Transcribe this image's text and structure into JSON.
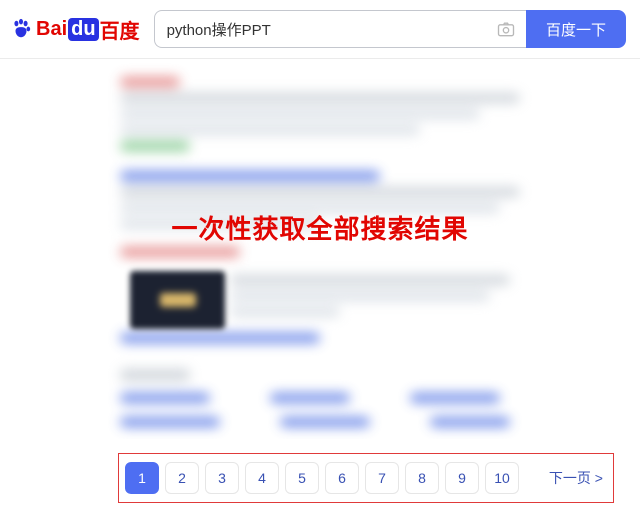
{
  "logo": {
    "bai": "Bai",
    "du": "du",
    "cn": "百度"
  },
  "search": {
    "query": "python操作PPT",
    "button_label": "百度一下"
  },
  "overlay": {
    "caption": "一次性获取全部搜索结果"
  },
  "pagination": {
    "pages": [
      "1",
      "2",
      "3",
      "4",
      "5",
      "6",
      "7",
      "8",
      "9",
      "10"
    ],
    "active_index": 0,
    "next_label": "下一页 >"
  }
}
